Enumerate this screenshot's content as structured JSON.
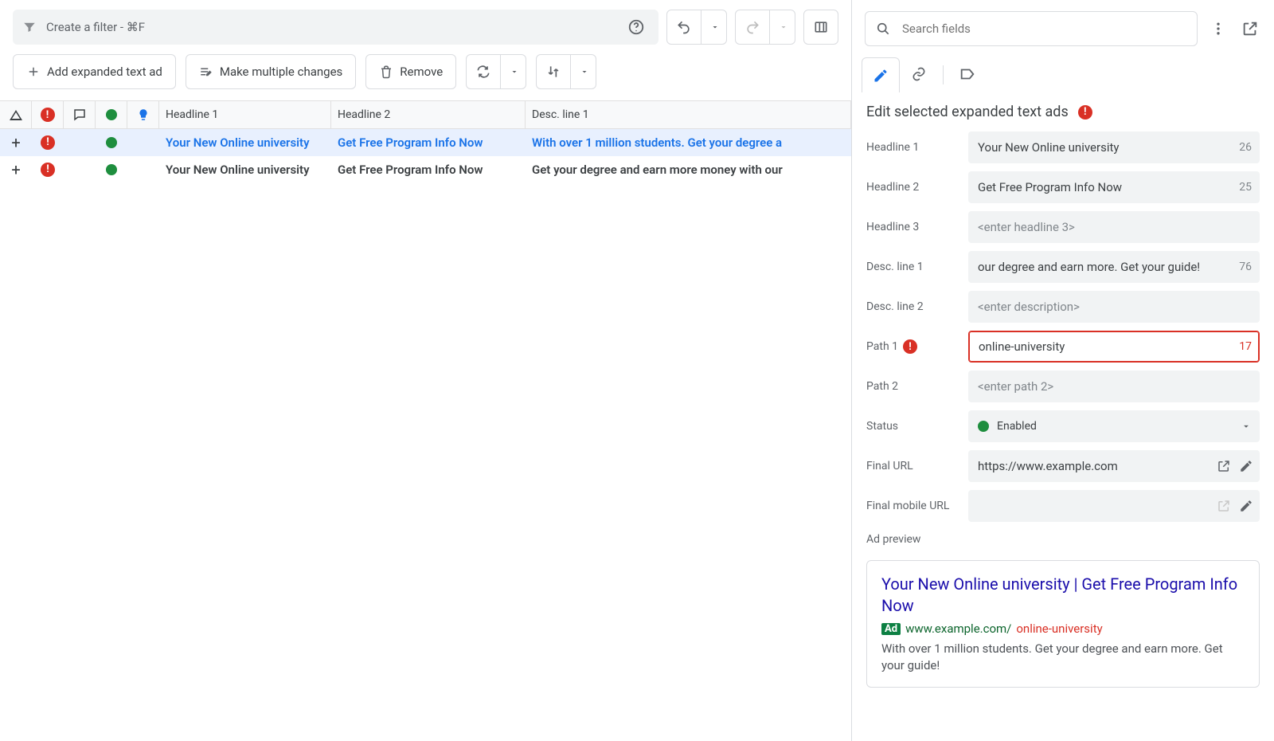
{
  "filter": {
    "placeholder": "Create a filter - ⌘F"
  },
  "toolbar": {
    "add_label": "Add expanded text ad",
    "multi_label": "Make multiple changes",
    "remove_label": "Remove"
  },
  "table": {
    "headers": {
      "h1": "Headline 1",
      "h2": "Headline 2",
      "d1": "Desc. line 1"
    },
    "rows": [
      {
        "selected": true,
        "h1": "Your New Online university",
        "h2": "Get Free Program Info Now",
        "d1": "With over 1 million students. Get your degree a"
      },
      {
        "selected": false,
        "h1": "Your New Online university",
        "h2": "Get Free Program Info Now",
        "d1": "Get your degree and earn more money with our"
      }
    ]
  },
  "panel": {
    "search_placeholder": "Search fields",
    "title": "Edit selected expanded text ads",
    "labels": {
      "h1": "Headline 1",
      "h2": "Headline 2",
      "h3": "Headline 3",
      "d1": "Desc. line 1",
      "d2": "Desc. line 2",
      "p1": "Path 1",
      "p2": "Path 2",
      "status": "Status",
      "final_url": "Final URL",
      "final_mobile": "Final mobile URL",
      "preview": "Ad preview"
    },
    "values": {
      "h1": "Your New Online university",
      "h1_count": "26",
      "h2": "Get Free Program Info Now",
      "h2_count": "25",
      "h3_ph": "<enter headline 3>",
      "d1": "our degree and earn more. Get your guide!",
      "d1_count": "76",
      "d2_ph": "<enter description>",
      "p1": "online-university",
      "p1_count": "17",
      "p2_ph": "<enter path 2>",
      "status": "Enabled",
      "final_url": "https://www.example.com"
    },
    "preview": {
      "title": "Your New Online university | Get Free Program Info Now",
      "ad_badge": "Ad",
      "domain": "www.example.com/",
      "path": "online-university",
      "desc": "With over 1 million students. Get your degree and earn more. Get your guide!"
    }
  }
}
